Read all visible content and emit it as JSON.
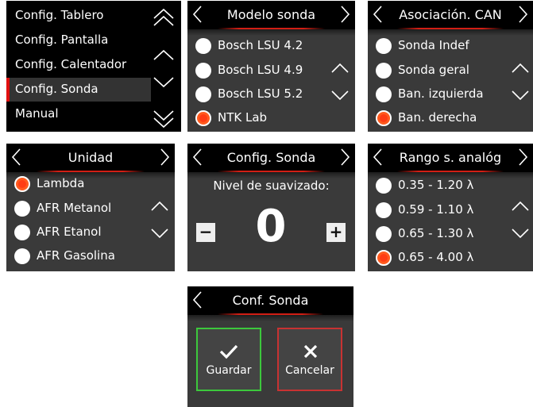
{
  "colors": {
    "accent_red": "#d21e14",
    "radio_selected": "#ff3c14",
    "panel_bg": "#3a3a3a",
    "header_bg": "#000000",
    "save_border": "#3cc83c",
    "cancel_border": "#c83232"
  },
  "menu": {
    "items": [
      "Config. Tablero",
      "Config. Pantalla",
      "Config. Calentador",
      "Config. Sonda",
      "Manual"
    ],
    "selected_index": 3
  },
  "modelo_sonda": {
    "title": "Modelo sonda",
    "options": [
      {
        "label": "Bosch LSU 4.2",
        "selected": false
      },
      {
        "label": "Bosch LSU 4.9",
        "selected": false
      },
      {
        "label": "Bosch LSU 5.2",
        "selected": false
      },
      {
        "label": "NTK Lab",
        "selected": true
      }
    ]
  },
  "asociacion_can": {
    "title": "Asociación. CAN",
    "options": [
      {
        "label": "Sonda Indef",
        "selected": false
      },
      {
        "label": "Sonda geral",
        "selected": false
      },
      {
        "label": "Ban. izquierda",
        "selected": false
      },
      {
        "label": "Ban. derecha",
        "selected": true
      }
    ]
  },
  "unidad": {
    "title": "Unidad",
    "options": [
      {
        "label": "Lambda",
        "selected": true
      },
      {
        "label": "AFR Metanol",
        "selected": false
      },
      {
        "label": "AFR Etanol",
        "selected": false
      },
      {
        "label": "AFR Gasolina",
        "selected": false
      }
    ]
  },
  "config_sonda": {
    "title": "Config. Sonda",
    "subtitle": "Nivel de suavizado:",
    "value": "0",
    "minus_label": "−",
    "plus_label": "+"
  },
  "rango": {
    "title": "Rango s. analóg",
    "options": [
      {
        "label": "0.35 - 1.20 λ",
        "selected": false
      },
      {
        "label": "0.59 - 1.10 λ",
        "selected": false
      },
      {
        "label": "0.65 - 1.30 λ",
        "selected": false
      },
      {
        "label": "0.65 - 4.00 λ",
        "selected": true
      }
    ]
  },
  "conf_sonda": {
    "title": "Conf. Sonda",
    "save_label": "Guardar",
    "cancel_label": "Cancelar"
  },
  "icons": [
    "chevron-left-icon",
    "chevron-right-icon",
    "chevron-up-icon",
    "chevron-down-icon",
    "double-chevron-up-icon",
    "double-chevron-down-icon",
    "checkmark-icon",
    "x-icon"
  ]
}
